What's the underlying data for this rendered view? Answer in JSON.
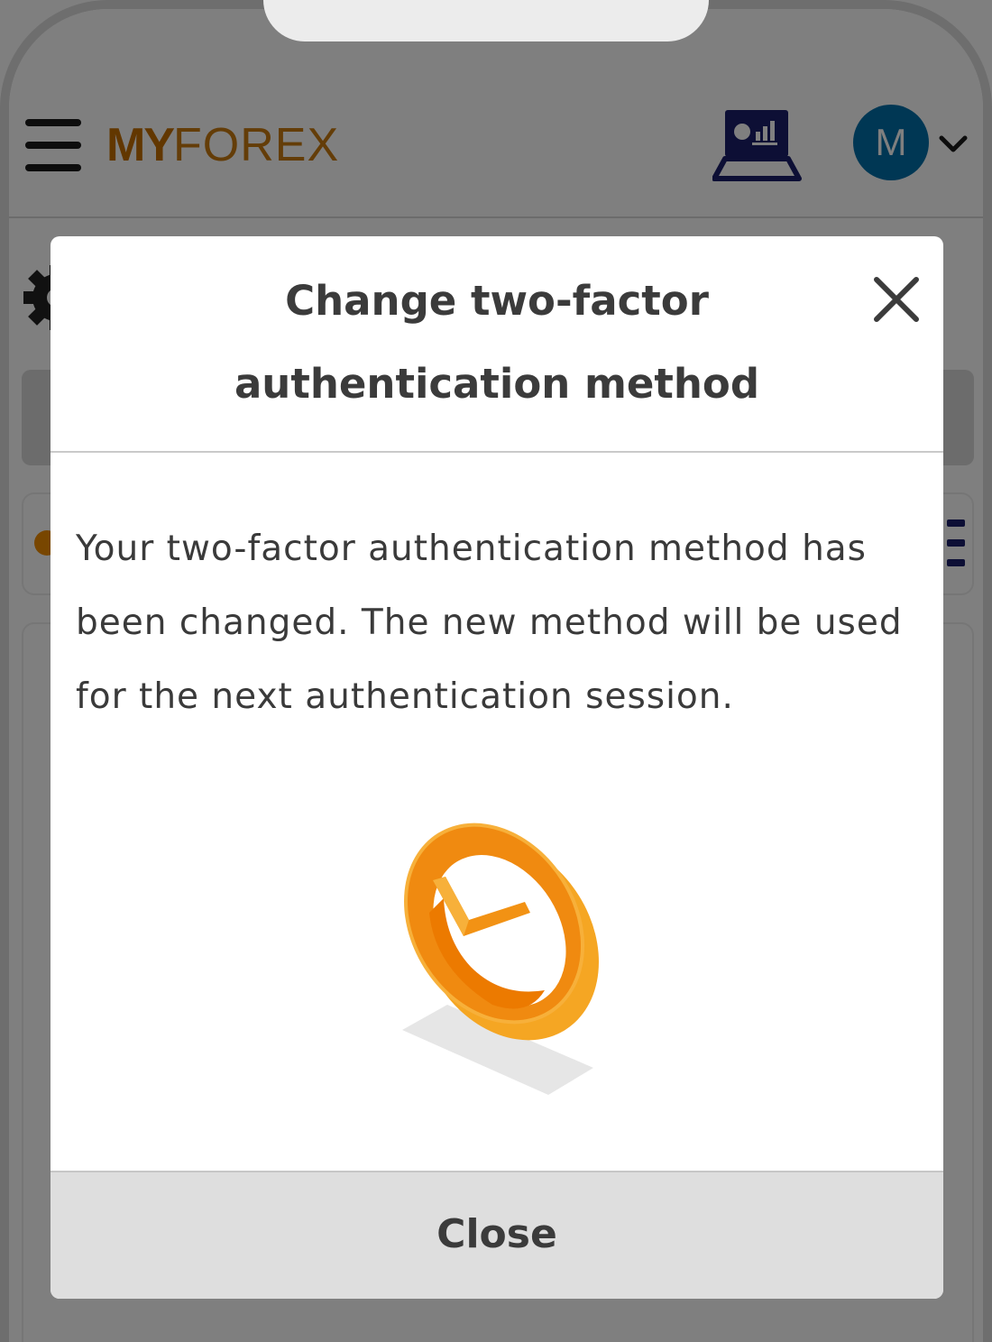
{
  "header": {
    "logo_my": "MY",
    "logo_forex": "FOREX",
    "avatar_initial": "M"
  },
  "modal": {
    "title": "Change two-factor authentication method",
    "message": "Your two-factor authentication method has been changed. The new method will be used for the next authentication session.",
    "close_button_label": "Close"
  },
  "colors": {
    "brand": "#c87a10",
    "avatar": "#006fa8",
    "success_orange": "#f5a623"
  },
  "icons": [
    "menu-icon",
    "trading-terminal-icon",
    "chevron-down-icon",
    "settings-gear-icon",
    "close-icon",
    "success-check-icon"
  ]
}
